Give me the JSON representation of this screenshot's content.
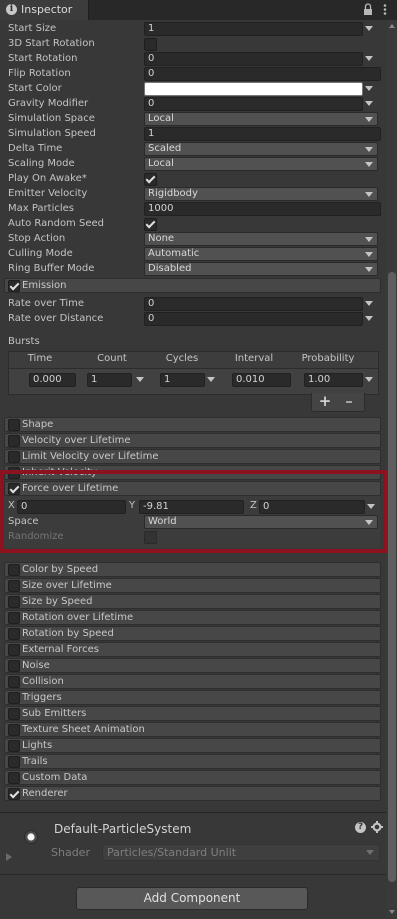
{
  "window": {
    "tab_title": "Inspector"
  },
  "main_module": {
    "rows": [
      {
        "label": "Start Size",
        "kind": "field",
        "value": "1",
        "arrow": true
      },
      {
        "label": "3D Start Rotation",
        "kind": "check",
        "checked": false
      },
      {
        "label": "Start Rotation",
        "kind": "field",
        "value": "0",
        "arrow": true
      },
      {
        "label": "Flip Rotation",
        "kind": "field",
        "value": "0",
        "arrow": false
      },
      {
        "label": "Start Color",
        "kind": "color",
        "value": "#ffffff",
        "arrow": true
      },
      {
        "label": "Gravity Modifier",
        "kind": "field",
        "value": "0",
        "arrow": true
      },
      {
        "label": "Simulation Space",
        "kind": "drop",
        "value": "Local"
      },
      {
        "label": "Simulation Speed",
        "kind": "field",
        "value": "1",
        "arrow": false
      },
      {
        "label": "Delta Time",
        "kind": "drop",
        "value": "Scaled"
      },
      {
        "label": "Scaling Mode",
        "kind": "drop",
        "value": "Local"
      },
      {
        "label": "Play On Awake*",
        "kind": "check",
        "checked": true
      },
      {
        "label": "Emitter Velocity",
        "kind": "drop",
        "value": "Rigidbody"
      },
      {
        "label": "Max Particles",
        "kind": "field",
        "value": "1000",
        "arrow": false
      },
      {
        "label": "Auto Random Seed",
        "kind": "check",
        "checked": true
      },
      {
        "label": "Stop Action",
        "kind": "drop",
        "value": "None"
      },
      {
        "label": "Culling Mode",
        "kind": "drop",
        "value": "Automatic"
      },
      {
        "label": "Ring Buffer Mode",
        "kind": "drop",
        "value": "Disabled"
      }
    ]
  },
  "emission": {
    "title": "Emission",
    "rate_over_time_label": "Rate over Time",
    "rate_over_time_value": "0",
    "rate_over_distance_label": "Rate over Distance",
    "rate_over_distance_value": "0",
    "bursts_label": "Bursts",
    "burst_headers": [
      "Time",
      "Count",
      "Cycles",
      "Interval",
      "Probability"
    ],
    "burst_row": {
      "time": "0.000",
      "count": "1",
      "cycles": "1",
      "interval": "0.010",
      "probability": "1.00"
    },
    "add_label": "+",
    "remove_label": "–"
  },
  "modules_before": [
    {
      "title": "Shape",
      "checked": false
    },
    {
      "title": "Velocity over Lifetime",
      "checked": false
    },
    {
      "title": "Limit Velocity over Lifetime",
      "checked": false
    },
    {
      "title": "Inherit Velocity",
      "checked": false
    }
  ],
  "force_module": {
    "title": "Force over Lifetime",
    "checked": true,
    "x_label": "X",
    "x_value": "0",
    "y_label": "Y",
    "y_value": "-9.81",
    "z_label": "Z",
    "z_value": "0",
    "space_label": "Space",
    "space_value": "World",
    "randomize_label": "Randomize",
    "highlight_color": "#8c1220"
  },
  "modules_after": [
    {
      "title": "Color by Speed",
      "checked": false
    },
    {
      "title": "Size over Lifetime",
      "checked": false
    },
    {
      "title": "Size by Speed",
      "checked": false
    },
    {
      "title": "Rotation over Lifetime",
      "checked": false
    },
    {
      "title": "Rotation by Speed",
      "checked": false
    },
    {
      "title": "External Forces",
      "checked": false
    },
    {
      "title": "Noise",
      "checked": false
    },
    {
      "title": "Collision",
      "checked": false
    },
    {
      "title": "Triggers",
      "checked": false
    },
    {
      "title": "Sub Emitters",
      "checked": false
    },
    {
      "title": "Texture Sheet Animation",
      "checked": false
    },
    {
      "title": "Lights",
      "checked": false
    },
    {
      "title": "Trails",
      "checked": false
    },
    {
      "title": "Custom Data",
      "checked": false
    },
    {
      "title": "Renderer",
      "checked": true
    }
  ],
  "material": {
    "name": "Default-ParticleSystem",
    "shader_label": "Shader",
    "shader_value": "Particles/Standard Unlit"
  },
  "footer": {
    "add_component_label": "Add Component"
  }
}
